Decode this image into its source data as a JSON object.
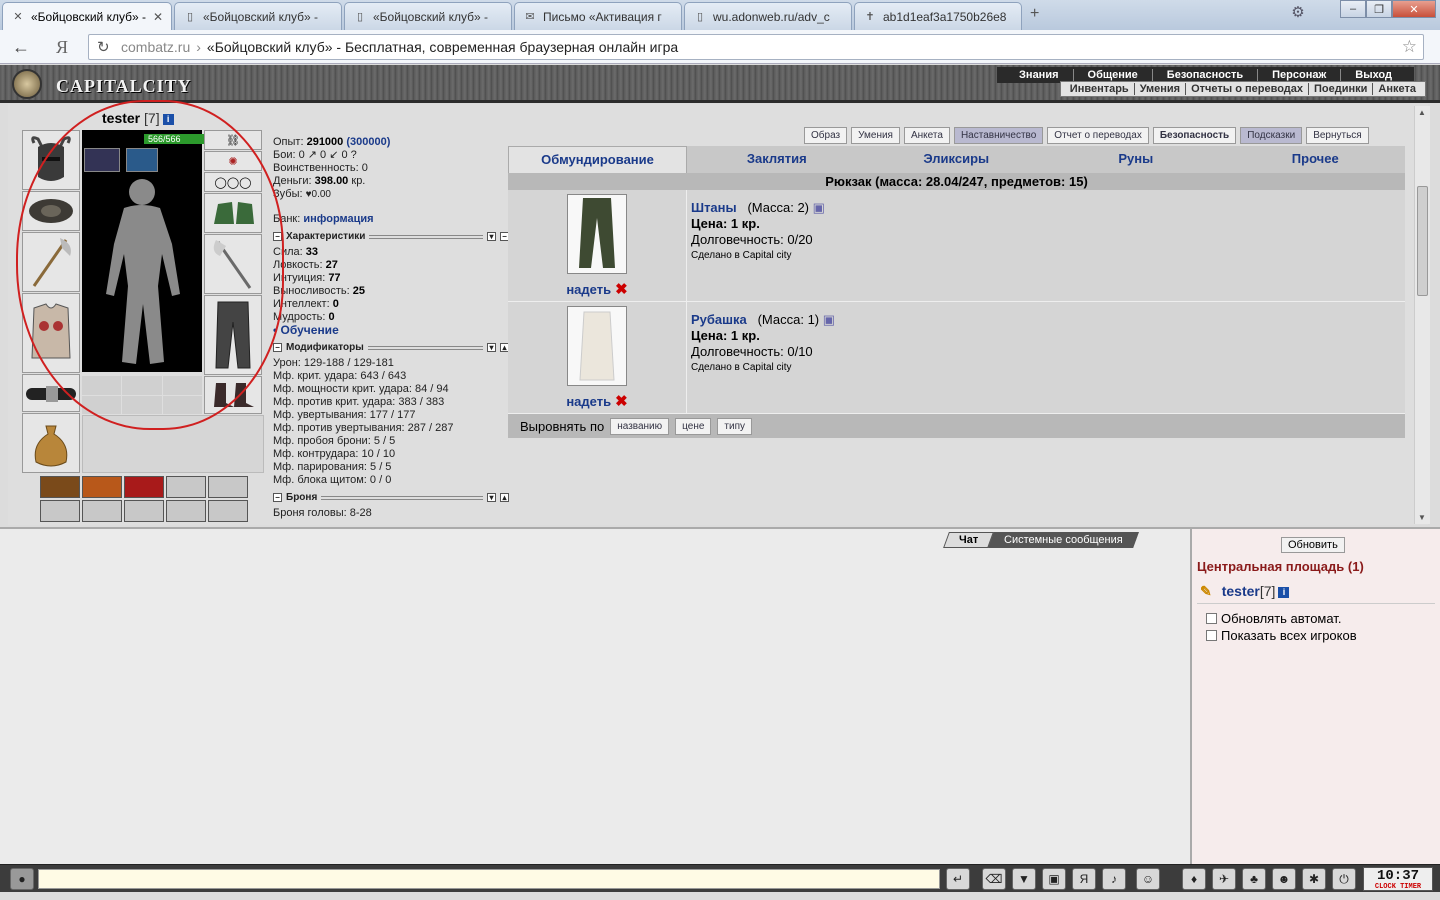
{
  "browser": {
    "tabs": [
      {
        "title": "«Бойцовский клуб» -",
        "active": true
      },
      {
        "title": "«Бойцовский клуб» -",
        "active": false
      },
      {
        "title": "«Бойцовский клуб» -",
        "active": false
      },
      {
        "title": "Письмо «Активация г",
        "active": false
      },
      {
        "title": "wu.adonweb.ru/adv_c",
        "active": false
      },
      {
        "title": "ab1d1eaf3a1750b26e8",
        "active": false
      }
    ],
    "address_host": "combatz.ru",
    "address_sep": "›",
    "address_title": "«Бойцовский клуб» - Бесплатная, современная браузерная онлайн игра"
  },
  "game_header": {
    "logo_text": "CAPITALCITY",
    "menu": [
      "Знания",
      "Общение",
      "Безопасность",
      "Персонаж",
      "Выход"
    ],
    "submenu": [
      "Инвентарь",
      "Умения",
      "Отчеты о переводах",
      "Поединки",
      "Анкета"
    ]
  },
  "character": {
    "name": "tester",
    "level": "[7]",
    "hp": "566/566",
    "hp_fraction": 1.0
  },
  "stats": {
    "exp_label": "Опыт:",
    "exp": "291000",
    "exp_next": "(300000)",
    "fights_label": "Бои:",
    "fights": "0 ↗  0 ↙  0 ?",
    "valor_label": "Воинственность:",
    "valor": "0",
    "money_label": "Деньги:",
    "money": "398.00",
    "money_unit": "кр.",
    "teeth_label": "Зубы:",
    "teeth": "♥0.00",
    "bank_label": "Банк:",
    "bank_link": "информация",
    "char_section": "Характеристики",
    "attrs": [
      {
        "label": "Сила:",
        "value": "33"
      },
      {
        "label": "Ловкость:",
        "value": "27"
      },
      {
        "label": "Интуиция:",
        "value": "77"
      },
      {
        "label": "Выносливость:",
        "value": "25"
      },
      {
        "label": "Интеллект:",
        "value": "0"
      },
      {
        "label": "Мудрость:",
        "value": "0"
      }
    ],
    "training": "• Обучение",
    "mod_section": "Модификаторы",
    "mods": [
      "Урон: 129-188 / 129-181",
      "Мф. крит. удара: 643 / 643",
      "Мф. мощности крит. удара: 84 / 94",
      "Мф. против крит. удара: 383 / 383",
      "Мф. увертывания: 177 / 177",
      "Мф. против увертывания: 287 / 287",
      "Мф. пробоя брони: 5 / 5",
      "Мф. контрудара: 10 / 10",
      "Мф. парирования: 5 / 5",
      "Мф. блока щитом: 0 / 0"
    ],
    "armor_section": "Броня",
    "armor": "Броня головы: 8-28"
  },
  "top_buttons": [
    "Образ",
    "Умения",
    "Анкета",
    "Наставничество",
    "Отчет о переводах",
    "Безопасность",
    "Подсказки",
    "Вернуться"
  ],
  "inv_tabs": [
    "Обмундирование",
    "Заклятия",
    "Эликсиры",
    "Руны",
    "Прочее"
  ],
  "backpack": "Рюкзак (масса: 28.04/247, предметов: 15)",
  "items": [
    {
      "name": "Штаны",
      "mass": "(Масса: 2)",
      "price_label": "Цена:",
      "price": "1 кр.",
      "durability": "Долговечность: 0/20",
      "made": "Сделано в Capital city",
      "wear": "надеть"
    },
    {
      "name": "Рубашка",
      "mass": "(Масса: 1)",
      "price_label": "Цена:",
      "price": "1 кр.",
      "durability": "Долговечность: 0/10",
      "made": "Сделано в Capital city",
      "wear": "надеть"
    }
  ],
  "sort": {
    "label": "Выровнять по",
    "buttons": [
      "названию",
      "цене",
      "типу"
    ]
  },
  "chat": {
    "tabs": [
      "Чат",
      "Системные сообщения"
    ]
  },
  "online": {
    "refresh": "Обновить",
    "room": "Центральная площадь (1)",
    "user": "tester",
    "user_level": "[7]",
    "auto_refresh": "Обновлять автомат.",
    "show_all": "Показать всех игроков"
  },
  "clock": {
    "time": "10:37",
    "label": "CLOCK TIMER"
  },
  "colors": {
    "link": "#1a3a8a",
    "hp": "#2c9a2c",
    "highlight_circle": "#d02020"
  }
}
